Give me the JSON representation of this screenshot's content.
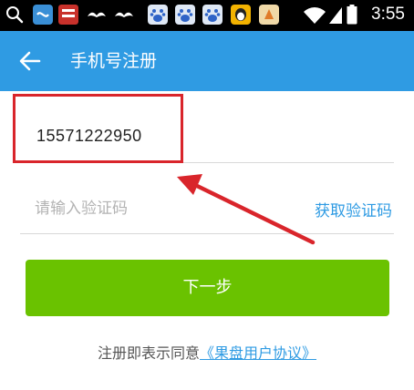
{
  "status_bar": {
    "time": "3:55",
    "icons": [
      "search-icon",
      "app-icon",
      "news-app-icon",
      "mustache-icon",
      "mustache-icon",
      "baidu-paw-icon",
      "baidu-paw-icon",
      "baidu-paw-icon",
      "qq-penguin-icon",
      "game-icon",
      "wifi-icon",
      "signal-icon",
      "battery-icon"
    ]
  },
  "app_bar": {
    "title": "手机号注册",
    "back_icon": "back-arrow-icon",
    "color": "#2f9be3"
  },
  "form": {
    "phone_value": "15571222950",
    "code_placeholder": "请输入验证码",
    "get_code_label": "获取验证码"
  },
  "next_button": {
    "label": "下一步",
    "color": "#6ac200"
  },
  "agreement": {
    "prefix": "注册即表示同意",
    "link": "《果盘用户协议》"
  },
  "annotation": {
    "highlight_color": "#d9252b"
  }
}
